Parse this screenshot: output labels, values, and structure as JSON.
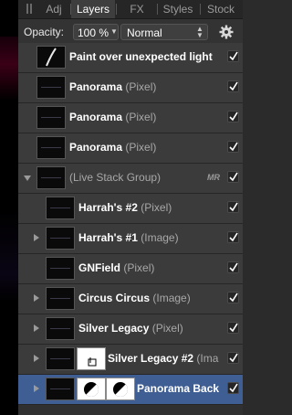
{
  "tabs": [
    {
      "label": "Adj"
    },
    {
      "label": "Layers"
    },
    {
      "label": "FX"
    },
    {
      "label": "Styles"
    },
    {
      "label": "Stock"
    }
  ],
  "active_tab": "Layers",
  "opacity": {
    "label": "Opacity:",
    "value": "100 %"
  },
  "blend_mode": {
    "value": "Normal"
  },
  "layers": [
    {
      "name": "Paint over unexpected light",
      "type": "",
      "thumb": "stroke",
      "visible": true
    },
    {
      "name": "Panorama",
      "type": "(Pixel)",
      "thumb": "dark",
      "visible": true
    },
    {
      "name": "Panorama",
      "type": "(Pixel)",
      "thumb": "dark",
      "visible": true
    },
    {
      "name": "Panorama",
      "type": "(Pixel)",
      "thumb": "dark",
      "visible": true
    },
    {
      "name": "",
      "type": "(Live Stack Group)",
      "badge": "MR",
      "thumb": "dark",
      "visible": true,
      "expander": "open"
    },
    {
      "name": "Harrah's #2",
      "type": "(Pixel)",
      "thumb": "dark",
      "visible": true
    },
    {
      "name": "Harrah's #1",
      "type": "(Image)",
      "thumb": "dark",
      "visible": true,
      "expander": "closed"
    },
    {
      "name": "GNField",
      "type": "(Pixel)",
      "thumb": "dark",
      "visible": true
    },
    {
      "name": "Circus Circus",
      "type": "(Image)",
      "thumb": "dark",
      "visible": true,
      "expander": "closed"
    },
    {
      "name": "Silver Legacy",
      "type": "(Pixel)",
      "thumb": "dark",
      "visible": true,
      "expander": "closed"
    },
    {
      "name": "Silver Legacy #2",
      "type": "(Ima",
      "thumb": "dark",
      "mask": "white",
      "visible": true,
      "expander": "closed"
    },
    {
      "name": "Panorama Back",
      "type": "",
      "thumb": "dark",
      "visible": true,
      "expander": "closed",
      "selected": true
    }
  ],
  "colors": {
    "selected_row": "#3f5f94",
    "panel": "#303030"
  },
  "icons": {
    "settings": "gear-icon",
    "visibility": "checkmark-icon"
  }
}
